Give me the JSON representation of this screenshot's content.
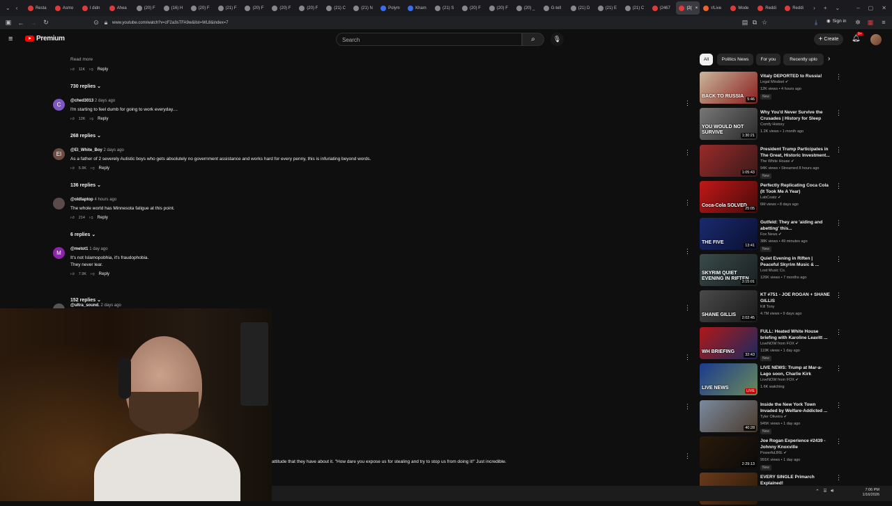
{
  "browser": {
    "tabs": [
      {
        "label": "Resta",
        "color": "#e03a3a"
      },
      {
        "label": "Asmo",
        "color": "#e03a3a"
      },
      {
        "label": "I didn",
        "color": "#e03a3a"
      },
      {
        "label": "Ahea",
        "color": "#e03a3a"
      },
      {
        "label": "(20) F",
        "color": "#888"
      },
      {
        "label": "(16) H",
        "color": "#888"
      },
      {
        "label": "(20) F",
        "color": "#888"
      },
      {
        "label": "(21) F",
        "color": "#888"
      },
      {
        "label": "(20) F",
        "color": "#888"
      },
      {
        "label": "(20) F",
        "color": "#888"
      },
      {
        "label": "(20) F",
        "color": "#888"
      },
      {
        "label": "(21) C",
        "color": "#888"
      },
      {
        "label": "(21) N",
        "color": "#888"
      },
      {
        "label": "Polym",
        "color": "#3b6cf0"
      },
      {
        "label": "Kham",
        "color": "#3b6cf0"
      },
      {
        "label": "(21) S",
        "color": "#888"
      },
      {
        "label": "(20) F",
        "color": "#888"
      },
      {
        "label": "(20) F",
        "color": "#888"
      },
      {
        "label": "(20) _",
        "color": "#888"
      },
      {
        "label": "G-tell",
        "color": "#888"
      },
      {
        "label": "(21) D",
        "color": "#888"
      },
      {
        "label": "(21) E",
        "color": "#888"
      },
      {
        "label": "(21) C",
        "color": "#888"
      },
      {
        "label": "(2467",
        "color": "#e03a3a"
      }
    ],
    "active_tab": {
      "label": "(2(",
      "close": "×"
    },
    "after_tabs": [
      {
        "label": "r/Live",
        "color": "#e8642a"
      },
      {
        "label": "Mode",
        "color": "#e03a3a"
      },
      {
        "label": "Reddi",
        "color": "#e03a3a"
      },
      {
        "label": "Reddi",
        "color": "#e03a3a"
      }
    ],
    "url": "www.youtube.com/watch?v=zF2a3sTFA9w&list=WL8&index=7",
    "signin": "Sign in"
  },
  "yt": {
    "logo": "Premium",
    "search_placeholder": "Search",
    "create_label": "Create",
    "notif_badge": "9+"
  },
  "comments": {
    "read_more": "Read more",
    "top_likes": "11K",
    "reply_label": "Reply",
    "replies_top": "730 replies",
    "items": [
      {
        "avatar": "C",
        "avatar_color": "#7e57c2",
        "handle": "@ched3013",
        "time": "2 days ago",
        "text": [
          "I'm starting to feel dumb for going to work everyday...."
        ],
        "likes": "12K",
        "replies": "268 replies"
      },
      {
        "avatar": "EI",
        "avatar_color": "#6d4c41",
        "handle": "@El_White_Boy",
        "time": "2 days ago",
        "text": [
          "As a father of 2 severely Autistic boys who gets absolutely no government assistance and works hard for every penny, this is infuriating beyond words."
        ],
        "likes": "5.9K",
        "replies": "136 replies"
      },
      {
        "avatar": "",
        "avatar_color": "#5a4a4a",
        "handle": "@oldlaptop",
        "time": "4 hours ago",
        "text": [
          "The whole world has Minnesota fatigue at this point."
        ],
        "likes": "214",
        "replies": "6 replies"
      },
      {
        "avatar": "M",
        "avatar_color": "#8e24aa",
        "handle": "@metot1",
        "time": "1 day ago",
        "text": [
          "It's not Islamopobhia, it's fraudophobia.",
          "They never lear."
        ],
        "likes": "7.9K",
        "replies": "152 replies"
      },
      {
        "avatar": "",
        "avatar_color": "#555",
        "handle": "@ultra_sound.",
        "time": "2 days ago",
        "text": [],
        "likes": "",
        "replies": ""
      }
    ],
    "bottom_text": "attitude that they have about it. \"How dare you expose us for stealing and try to stop us from doing it!\" Just incredible."
  },
  "chips": [
    "All",
    "Politics News",
    "For you",
    "Recently uplo"
  ],
  "videos": [
    {
      "title": "Vitaly DEPORTED to Russia!",
      "channel": "Legal Mindset",
      "verified": true,
      "meta": "12K views • 4 hours ago",
      "new": true,
      "duration": "5:46",
      "thumb_text": "BACK TO RUSSIA",
      "colors": [
        "#c9b69a",
        "#8a1f1f"
      ]
    },
    {
      "title": "Why You'd Never Survive the Crusades | History for Sleep",
      "channel": "Comfy History",
      "verified": false,
      "meta": "1.2K views • 1 month ago",
      "new": false,
      "duration": "1:30:21",
      "thumb_text": "YOU WOULD NOT SURVIVE",
      "colors": [
        "#777",
        "#2a2a2a"
      ]
    },
    {
      "title": "President Trump Participates in The Great, Historic Investment...",
      "channel": "The White House",
      "verified": true,
      "meta": "94K views • Streamed 8 hours ago",
      "new": true,
      "duration": "1:05:43",
      "thumb_text": "",
      "colors": [
        "#9a2a2a",
        "#3a1a1a"
      ]
    },
    {
      "title": "Perfectly Replicating Coca Cola (It Took Me A Year)",
      "channel": "LabCoatz",
      "verified": true,
      "meta": "6M views • 8 days ago",
      "new": false,
      "duration": "25:05",
      "thumb_text": "Coca-Cola SOLVED",
      "colors": [
        "#c01818",
        "#4a0a0a"
      ]
    },
    {
      "title": "Gutfeld: They are 'aiding and abetting' this...",
      "channel": "Fox News",
      "verified": true,
      "meta": "38K views • 49 minutes ago",
      "new": true,
      "duration": "13:41",
      "thumb_text": "THE FIVE",
      "colors": [
        "#1a2a70",
        "#0a1030"
      ]
    },
    {
      "title": "Quiet Evening in Riften | Peaceful Skyrim Music & ...",
      "channel": "Lost Music Co.",
      "verified": false,
      "meta": "126K views • 7 months ago",
      "new": false,
      "duration": "3:15:01",
      "thumb_text": "SKYRIM QUIET EVENING IN RIFTEN",
      "colors": [
        "#3a4a4a",
        "#1a2020"
      ]
    },
    {
      "title": "KT #751 - JOE ROGAN + SHANE GILLIS",
      "channel": "Kill Tony",
      "verified": false,
      "meta": "4.7M views • 9 days ago",
      "new": false,
      "duration": "2:02:45",
      "thumb_text": "SHANE GILLIS",
      "colors": [
        "#4a4a4a",
        "#1a1a1a"
      ]
    },
    {
      "title": "FULL: Heated White House briefing with Karoline Leavitt ...",
      "channel": "LiveNOW from FOX",
      "verified": true,
      "meta": "119K views • 1 day ago",
      "new": true,
      "duration": "32:43",
      "thumb_text": "WH BRIEFING",
      "colors": [
        "#b01818",
        "#1a2a60"
      ]
    },
    {
      "title": "LIVE NEWS: Trump at Mar-a-Lago soon, Charlie Kirk murde...",
      "channel": "LiveNOW from FOX",
      "verified": true,
      "meta": "1.6K watching",
      "new": false,
      "duration": "LIVE",
      "thumb_text": "LIVE NEWS",
      "colors": [
        "#1a3a90",
        "#6a8a5a"
      ]
    },
    {
      "title": "Inside the New York Town Invaded by Welfare-Addicted ...",
      "channel": "Tyler Oliveira",
      "verified": true,
      "meta": "945K views • 1 day ago",
      "new": true,
      "duration": "40:28",
      "thumb_text": "",
      "colors": [
        "#7a8aa0",
        "#4a3a2a"
      ]
    },
    {
      "title": "Joe Rogan Experience #2439 - Johnny Knoxville",
      "channel": "PowerfulJRE",
      "verified": true,
      "meta": "991K views • 1 day ago",
      "new": true,
      "duration": "2:29:13",
      "thumb_text": "",
      "colors": [
        "#2a1a0a",
        "#0a0a0a"
      ]
    },
    {
      "title": "EVERY SINGLE Primarch Explained!",
      "channel": "",
      "verified": false,
      "meta": "",
      "new": false,
      "duration": "",
      "thumb_text": "",
      "colors": [
        "#6a3a1a",
        "#2a1a0a"
      ]
    }
  ],
  "taskbar": {
    "time": "7:06 PM",
    "date": "1/16/2026"
  }
}
